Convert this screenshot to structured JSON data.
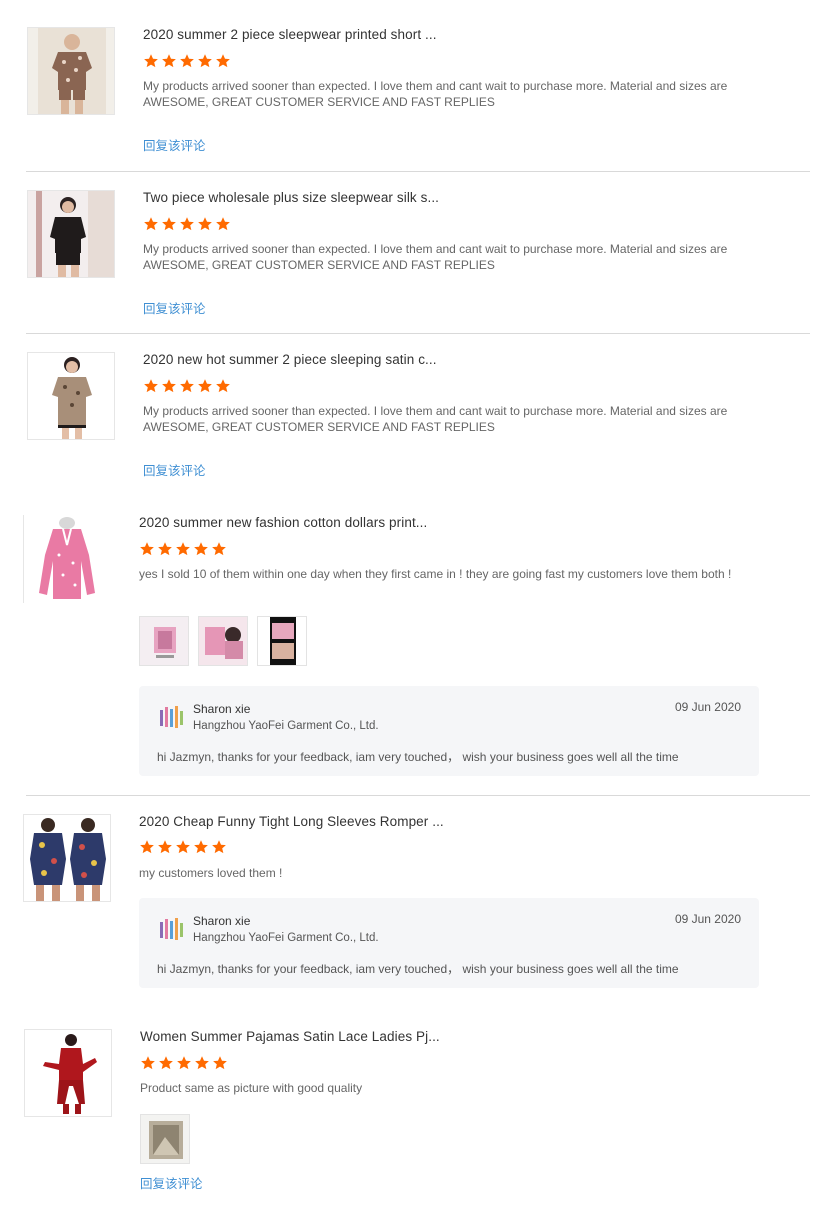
{
  "colors": {
    "star": "#ff6a00",
    "link": "#3f8fd3",
    "reply_bg": "#f5f6f8"
  },
  "reviews": [
    {
      "title": "2020 summer 2 piece sleepwear printed short ...",
      "rating": 5,
      "comment": "My products arrived sooner than expected. I love them and cant wait to purchase more. Material and sizes are AWESOME, GREAT CUSTOMER SERVICE AND FAST REPLIES",
      "reply_link": "回复该评论",
      "thumb_icon": "pajama-product-image"
    },
    {
      "title": "Two piece wholesale plus size sleepwear silk s...",
      "rating": 5,
      "comment": "My products arrived sooner than expected. I love them and cant wait to purchase more. Material and sizes are AWESOME, GREAT CUSTOMER SERVICE AND FAST REPLIES",
      "reply_link": "回复该评论",
      "thumb_icon": "pajama-product-image"
    },
    {
      "title": "2020 new hot summer 2 piece sleeping satin c...",
      "rating": 5,
      "comment": "My products arrived sooner than expected. I love them and cant wait to purchase more. Material and sizes are AWESOME, GREAT CUSTOMER SERVICE AND FAST REPLIES",
      "reply_link": "回复该评论",
      "thumb_icon": "pajama-product-image"
    },
    {
      "title": "2020 summer new fashion cotton dollars print...",
      "rating": 5,
      "comment": "yes I sold 10 of them within one day when they first came in  ! they are going fast my customers love them both !",
      "reply": {
        "name": "Sharon xie",
        "company": "Hangzhou YaoFei Garment Co., Ltd.",
        "date": "09 Jun 2020",
        "message": "hi Jazmyn,  thanks for your feedback, iam very touched，  wish your business goes well all the time"
      },
      "thumb_icon": "romper-product-image"
    },
    {
      "title": "2020 Cheap Funny Tight Long Sleeves Romper ...",
      "rating": 5,
      "comment": "my customers loved them !",
      "reply": {
        "name": "Sharon xie",
        "company": "Hangzhou YaoFei Garment Co., Ltd.",
        "date": "09 Jun 2020",
        "message": "hi Jazmyn,  thanks for your feedback, iam very touched，  wish your business goes well all the time"
      },
      "thumb_icon": "romper-product-image"
    },
    {
      "title": "Women Summer Pajamas Satin Lace Ladies Pj...",
      "rating": 5,
      "comment": "Product same as picture with good quality",
      "reply_link": "回复该评论",
      "thumb_icon": "satin-pajama-product-image"
    }
  ]
}
